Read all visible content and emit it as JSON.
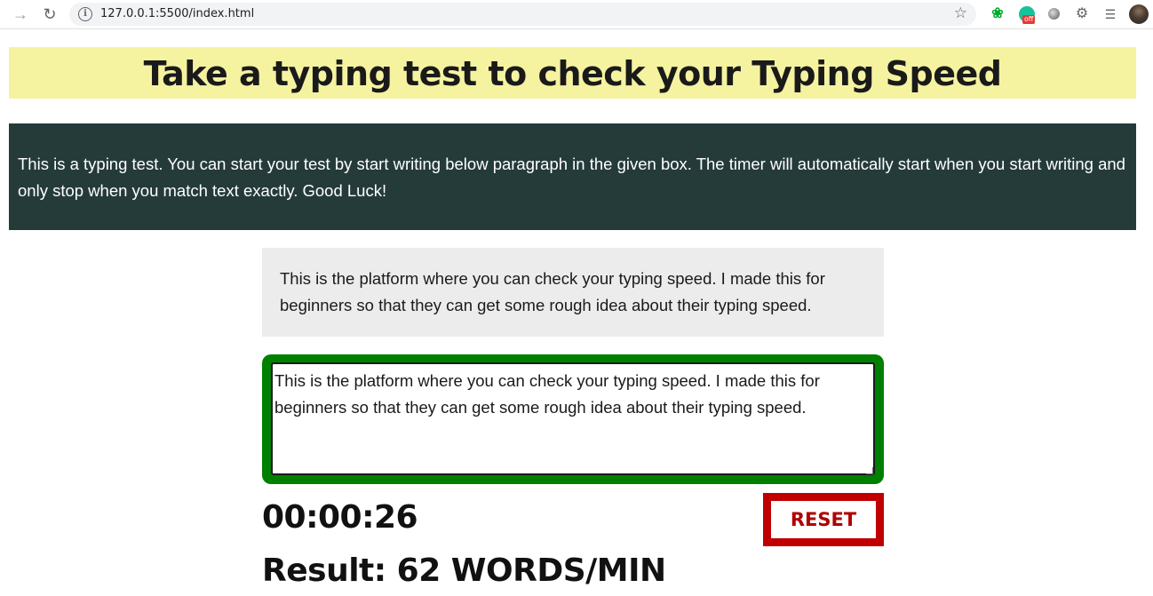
{
  "browser": {
    "url": "127.0.0.1:5500/index.html",
    "extension_badge": "off",
    "icons": [
      "forward-arrow-icon",
      "reload-icon",
      "info-icon",
      "star-icon",
      "evernote-icon",
      "grammarly-icon",
      "circle-extension-icon",
      "puzzle-icon",
      "media-control-icon",
      "profile-avatar"
    ]
  },
  "page": {
    "title": "Take a typing test to check your Typing Speed",
    "instructions": "This is a typing test. You can start your test by start writing below paragraph in the given box. The timer will automatically start when you start writing and only stop when you match text exactly. Good Luck!",
    "source_text": "This is the platform where you can check your typing speed. I made this for beginners so that they can get some rough idea about their typing speed.",
    "typed_text": "This is the platform where you can check your typing speed. I made this for beginners so that they can get some rough idea about their typing speed.",
    "timer": "00:00:26",
    "reset_label": "RESET",
    "result": "Result: 62 WORDS/MIN"
  },
  "colors": {
    "header_bg": "#f5f3a0",
    "intro_bg": "#243b3a",
    "source_bg": "#ececec",
    "input_border_success": "#008000",
    "reset_border": "#c00000"
  }
}
